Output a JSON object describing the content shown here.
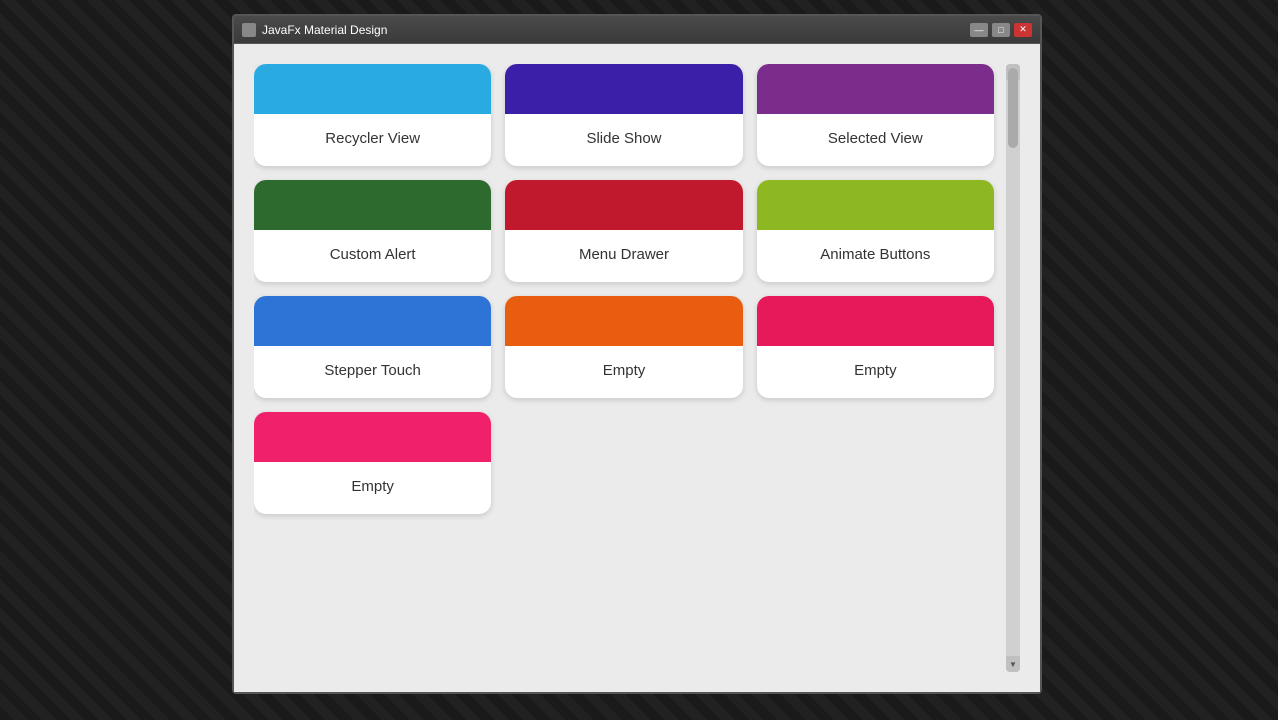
{
  "window": {
    "title": "JavaFx Material Design",
    "controls": {
      "minimize": "—",
      "maximize": "□",
      "close": "✕"
    }
  },
  "cards": [
    {
      "id": "recycler-view",
      "label": "Recycler View",
      "color_class": "color-blue"
    },
    {
      "id": "slide-show",
      "label": "Slide Show",
      "color_class": "color-indigo"
    },
    {
      "id": "selected-view",
      "label": "Selected View",
      "color_class": "color-purple"
    },
    {
      "id": "custom-alert",
      "label": "Custom Alert",
      "color_class": "color-green"
    },
    {
      "id": "menu-drawer",
      "label": "Menu Drawer",
      "color_class": "color-red"
    },
    {
      "id": "animate-buttons",
      "label": "Animate Buttons",
      "color_class": "color-lime"
    },
    {
      "id": "stepper-touch",
      "label": "Stepper Touch",
      "color_class": "color-royal-blue"
    },
    {
      "id": "empty-1",
      "label": "Empty",
      "color_class": "color-orange"
    },
    {
      "id": "empty-2",
      "label": "Empty",
      "color_class": "color-pink"
    },
    {
      "id": "empty-3",
      "label": "Empty",
      "color_class": "color-hot-pink"
    }
  ]
}
